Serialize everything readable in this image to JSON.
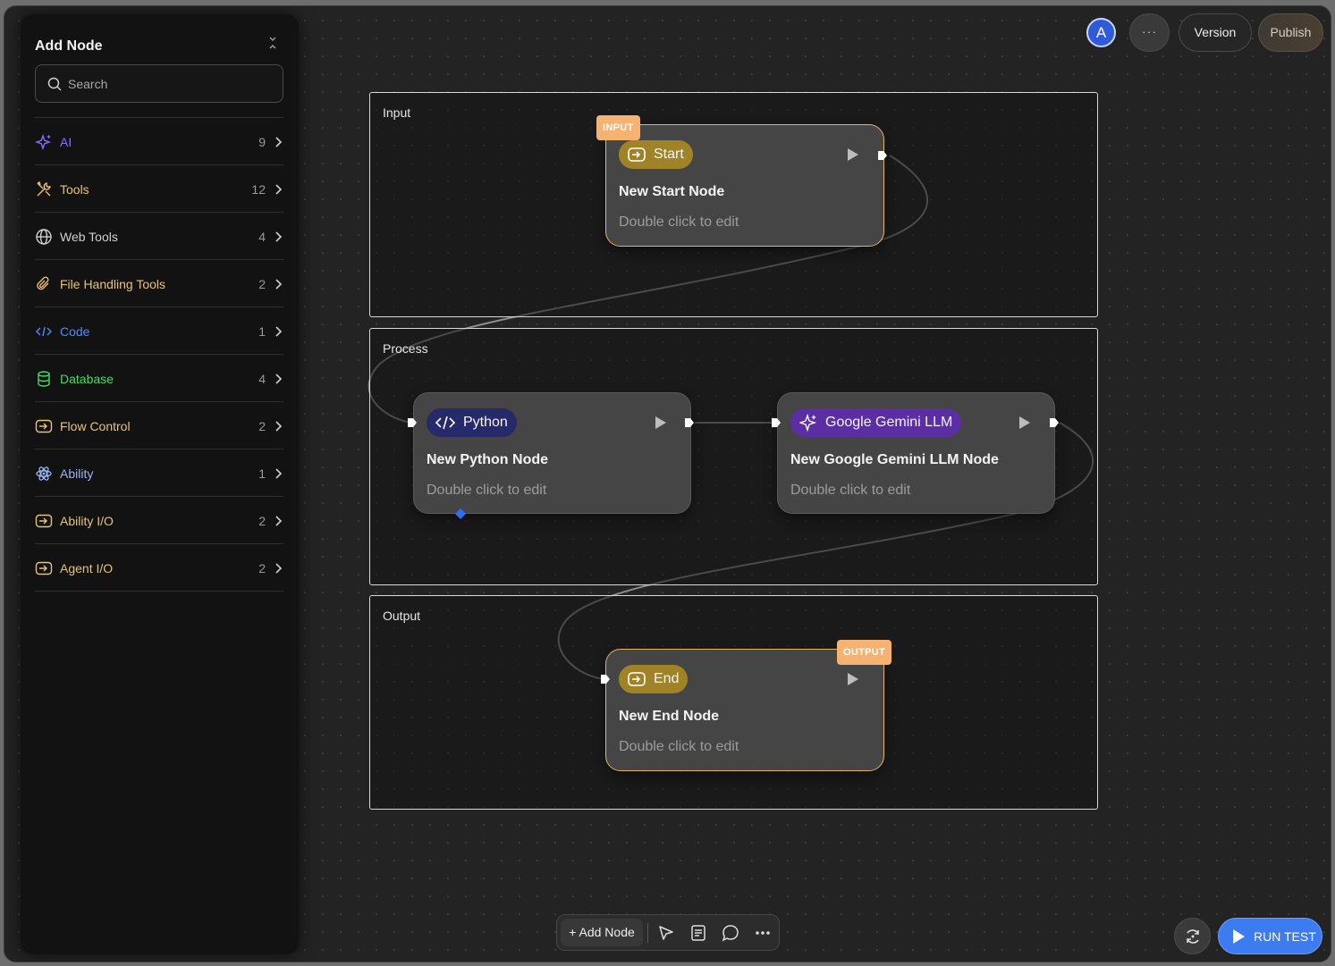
{
  "panel": {
    "title": "Add Node",
    "search_placeholder": "Search",
    "categories": [
      {
        "label": "AI",
        "count": "9",
        "color": "#8b6cff",
        "icon": "sparkles-icon"
      },
      {
        "label": "Tools",
        "count": "12",
        "color": "#e8c27a",
        "icon": "tools-icon"
      },
      {
        "label": "Web Tools",
        "count": "4",
        "color": "#cfcfcf",
        "icon": "globe-icon"
      },
      {
        "label": "File Handling Tools",
        "count": "2",
        "color": "#e8c27a",
        "icon": "paperclip-icon"
      },
      {
        "label": "Code",
        "count": "1",
        "color": "#4f8cff",
        "icon": "code-icon"
      },
      {
        "label": "Database",
        "count": "4",
        "color": "#4cd964",
        "icon": "database-icon"
      },
      {
        "label": "Flow Control",
        "count": "2",
        "color": "#e8c27a",
        "icon": "enter-icon"
      },
      {
        "label": "Ability",
        "count": "1",
        "color": "#9ab6f2",
        "icon": "atom-icon"
      },
      {
        "label": "Ability I/O",
        "count": "2",
        "color": "#e8c27a",
        "icon": "enter-icon"
      },
      {
        "label": "Agent I/O",
        "count": "2",
        "color": "#e8c27a",
        "icon": "enter-icon"
      }
    ]
  },
  "header": {
    "avatar_letter": "A",
    "more_label": "···",
    "version_label": "Version",
    "publish_label": "Publish"
  },
  "groups": {
    "input": "Input",
    "process": "Process",
    "output": "Output"
  },
  "nodes": {
    "start": {
      "tag": "INPUT",
      "pill": "Start",
      "title": "New Start Node",
      "subtitle": "Double click to edit"
    },
    "python": {
      "pill": "Python",
      "title": "New Python Node",
      "subtitle": "Double click to edit"
    },
    "gemini": {
      "pill": "Google Gemini LLM",
      "title": "New Google Gemini LLM Node",
      "subtitle": "Double click to edit"
    },
    "end": {
      "tag": "OUTPUT",
      "pill": "End",
      "title": "New End Node",
      "subtitle": "Double click to edit"
    }
  },
  "toolbar": {
    "add_node_label": "+ Add Node"
  },
  "run": {
    "label": "RUN TEST"
  },
  "colors": {
    "accent": "#3d7cf0",
    "io_border": "#e2b565",
    "io_tag": "#f5b270",
    "start_pill": "#a08326",
    "python_pill": "#26296a",
    "gemini_pill": "#5b2fa3"
  }
}
